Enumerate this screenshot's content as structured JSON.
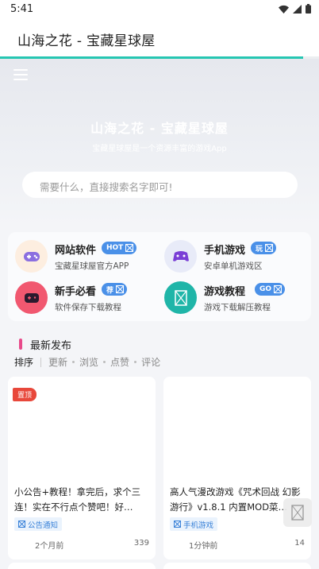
{
  "status": {
    "time": "5:41"
  },
  "appbar": {
    "title": "山海之花 - 宝藏星球屋",
    "progress_percent": 95
  },
  "hero": {
    "title": "山海之花 - 宝藏星球屋",
    "subtitle": "宝藏星球屋是一个资源丰富的游戏App",
    "search_placeholder": "需要什么，直接搜索名字即可!"
  },
  "categories": [
    {
      "name": "网站软件",
      "badge": "HOT",
      "desc": "宝藏星球屋官方APP",
      "icon": "gamepad-icon"
    },
    {
      "name": "手机游戏",
      "badge": "玩",
      "desc": "安卓单机游戏区",
      "icon": "controller-icon"
    },
    {
      "name": "新手必看",
      "badge": "荐",
      "desc": "软件保存下载教程",
      "icon": "handheld-icon"
    },
    {
      "name": "游戏教程",
      "badge": "GO",
      "desc": "游戏下载解压教程",
      "icon": "broken-image-icon"
    }
  ],
  "section": {
    "title": "最新发布"
  },
  "sort": {
    "label": "排序",
    "options": [
      "更新",
      "浏览",
      "点赞",
      "评论"
    ]
  },
  "posts": [
    {
      "pin": "置顶",
      "title": "小公告+教程！拿完后，求个三连！实在不行点个赞吧！好…",
      "tag": "公告通知",
      "time": "2个月前",
      "count": "339"
    },
    {
      "title": "高人气漫改游戏《咒术回战 幻影游行》v1.8.1 内置MOD菜…",
      "tag": "手机游戏",
      "time": "1分钟前",
      "count": "14"
    }
  ],
  "colors": {
    "accent": "#26c6b2",
    "badge": "#4a90e8",
    "section_bar": "#e84a8a",
    "pin": "#e8483b"
  }
}
